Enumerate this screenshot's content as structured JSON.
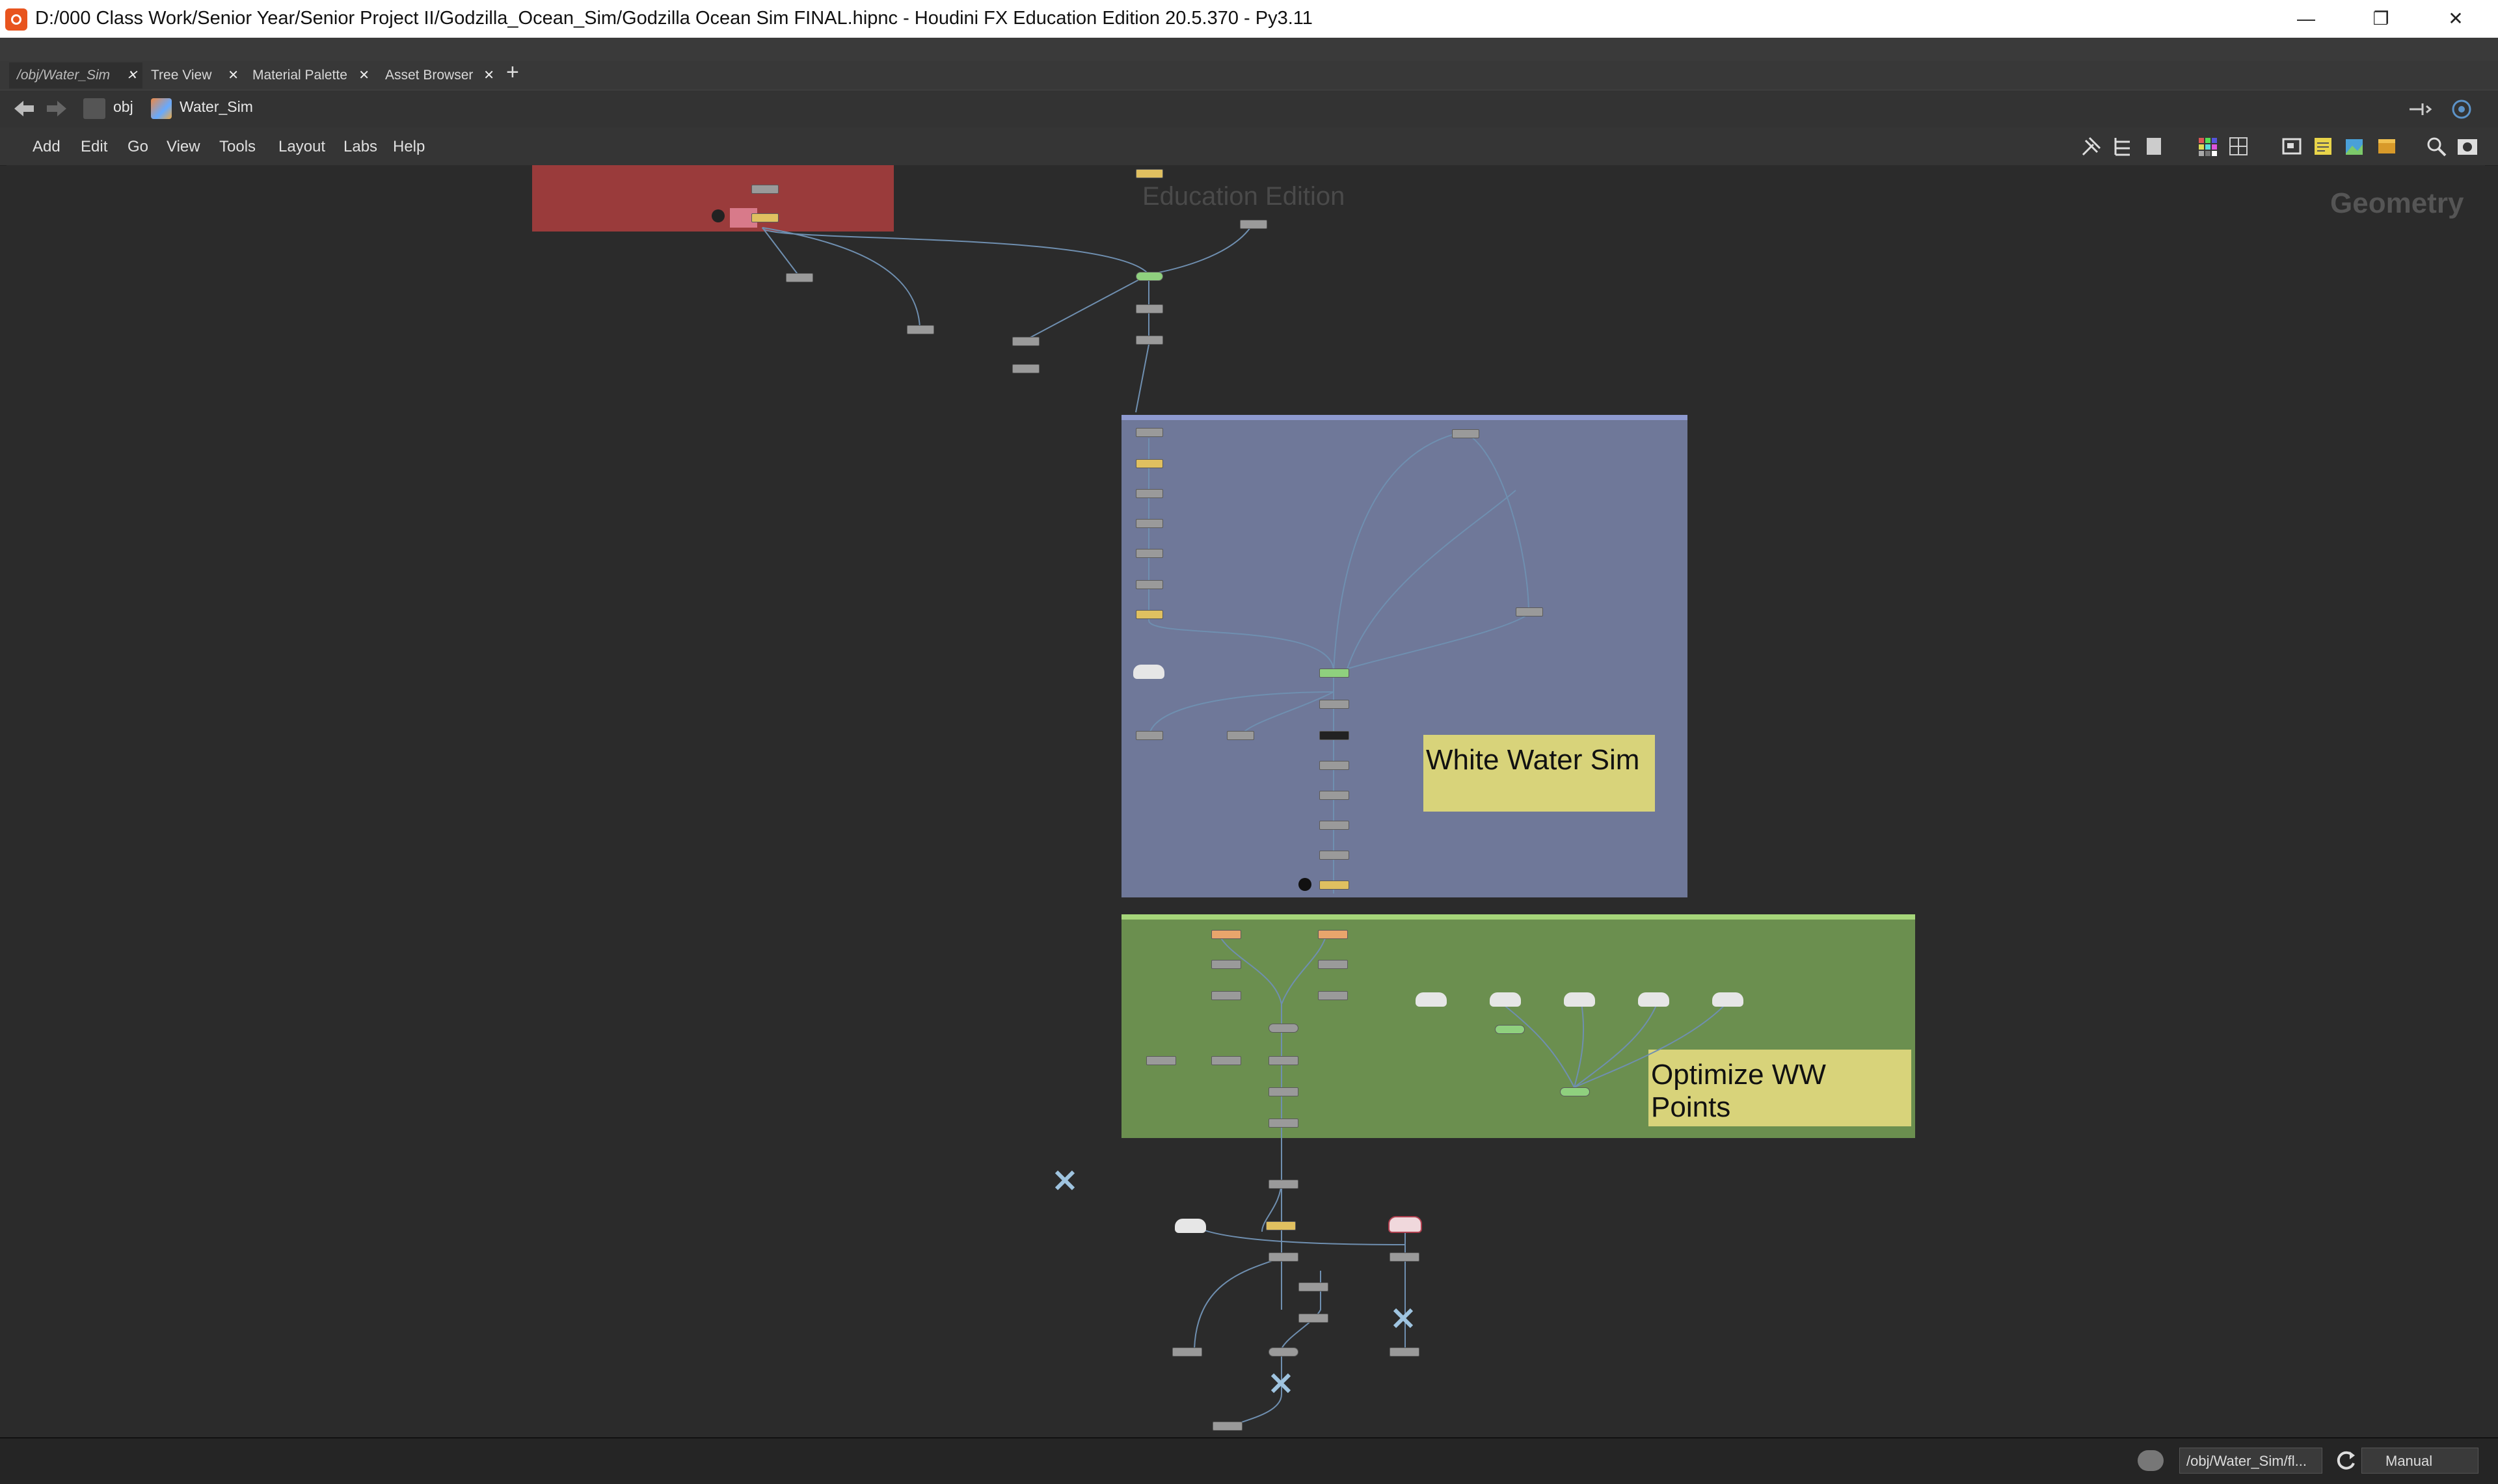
{
  "window": {
    "title": "D:/000 Class Work/Senior Year/Senior Project II/Godzilla_Ocean_Sim/Godzilla Ocean Sim FINAL.hipnc - Houdini FX Education Edition 20.5.370 - Py3.11",
    "controls": [
      "—",
      "❐",
      "✕"
    ]
  },
  "tabs": [
    {
      "label": "/obj/Water_Sim",
      "close": "✕"
    },
    {
      "label": "Tree View",
      "close": "✕"
    },
    {
      "label": "Material Palette",
      "close": "✕"
    },
    {
      "label": "Asset Browser",
      "close": "✕"
    }
  ],
  "tab_add": "+",
  "pathbar": {
    "root": "obj",
    "current": "Water_Sim"
  },
  "menu": [
    "Add",
    "Edit",
    "Go",
    "View",
    "Tools",
    "Layout",
    "Labs",
    "Help"
  ],
  "network": {
    "watermark_edu": "Education Edition",
    "context_label": "Geometry",
    "sticky_white_water": "White Water Sim",
    "sticky_optimize": "Optimize WW Points",
    "netbox_colors": {
      "red": "#9a3b3b",
      "blue": "#6f7899",
      "green": "#6b8f4f"
    }
  },
  "statusbar": {
    "path": "/obj/Water_Sim/fl...",
    "cook_mode": "Manual"
  }
}
